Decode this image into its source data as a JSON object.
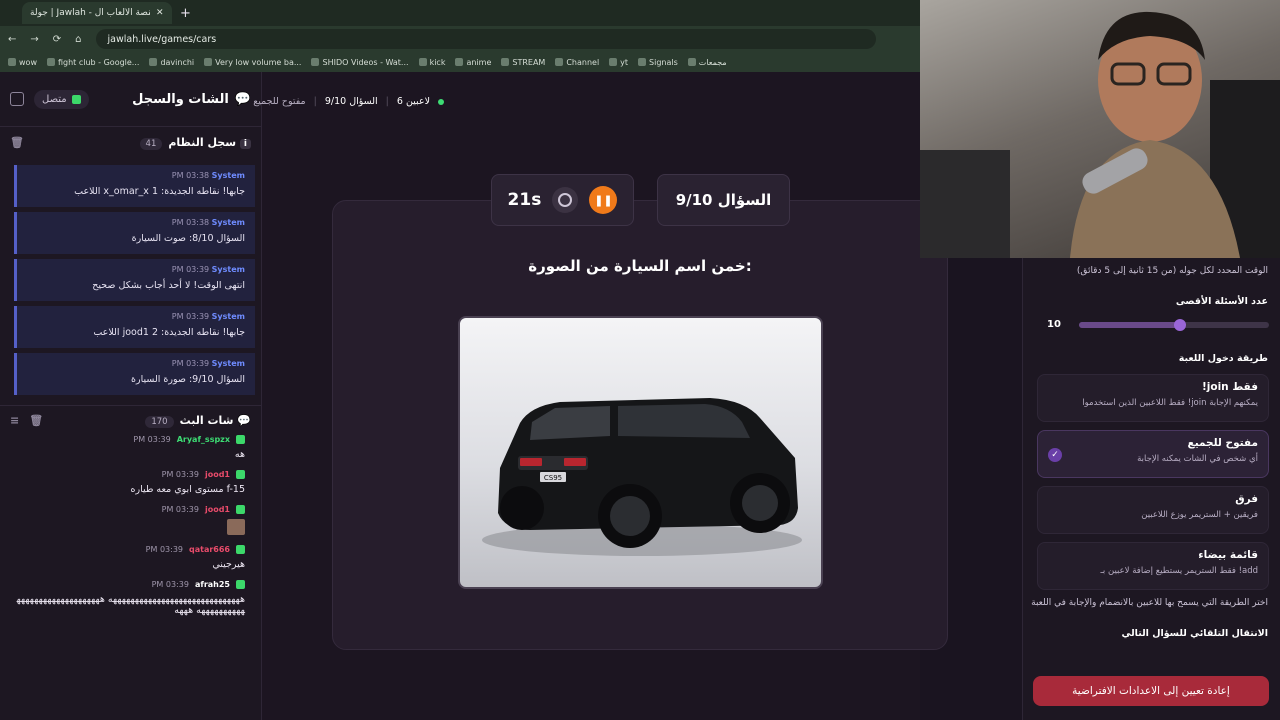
{
  "browser": {
    "tab_title": "جولة | Jawlah - منصة الألعاب ال...",
    "url": "jawlah.live/games/cars",
    "bookmarks": [
      "wow",
      "fight club - Google...",
      "davinchi",
      "Very low volume ba...",
      "SHIDO Videos - Wat...",
      "kick",
      "anime",
      "STREAM",
      "Channel",
      "yt",
      "Signals",
      "مجمعات"
    ]
  },
  "left_panel": {
    "title": "الشات والسجل",
    "status": "متصل",
    "system_log": {
      "title": "سجل النظام",
      "count": "41",
      "messages": [
        {
          "time": "PM 03:38",
          "sender": "System",
          "text": "اللاعب x_omar_x جابها! نقاطه الجديدة: 1"
        },
        {
          "time": "PM 03:38",
          "sender": "System",
          "text": "السؤال 8/10: صوت السيارة"
        },
        {
          "time": "PM 03:39",
          "sender": "System",
          "text": "انتهى الوقت! لا أحد أجاب بشكل صحيح"
        },
        {
          "time": "PM 03:39",
          "sender": "System",
          "text": "اللاعب jood1 جابها! نقاطه الجديدة: 2"
        },
        {
          "time": "PM 03:39",
          "sender": "System",
          "text": "السؤال 9/10: صورة السيارة"
        }
      ]
    },
    "live_chat": {
      "title": "شات البث",
      "count": "170",
      "messages": [
        {
          "time": "PM 03:39",
          "user": "Aryaf_sspzx",
          "color": "#3ddc74",
          "text": "هه"
        },
        {
          "time": "PM 03:39",
          "user": "jood1",
          "color": "#e84b6a",
          "text": "مستوى ابوي معه طياره f-15"
        },
        {
          "time": "PM 03:39",
          "user": "jood1",
          "color": "#e84b6a",
          "text": ""
        },
        {
          "time": "PM 03:39",
          "user": "qatar666",
          "color": "#e84b6a",
          "text": "هيرجيني"
        },
        {
          "time": "PM 03:39",
          "user": "afrah25",
          "color": "#ffffff",
          "text": "ههههههههههههههههههههههههههههههه ههههههههههههههههههههههههههههههه هههه"
        }
      ]
    }
  },
  "game": {
    "breadcrumb": {
      "players": "6 لاعبين",
      "question": "السؤال 9/10",
      "mode": "مفتوح للجميع"
    },
    "timer": "21s",
    "question_counter": "السؤال 9/10",
    "prompt": "خمن اسم السيارة من الصورة:",
    "plate_text": "CS95"
  },
  "settings": {
    "time_hint": "الوقت المحدد لكل جوله (من 15 ثانية إلى 5 دقائق)",
    "max_questions_label": "عدد الأسئلة الأقصى",
    "max_questions_value": "10",
    "max_questions_fraction": 0.53,
    "join_method_label": "طريقة دخول اللعبة",
    "options": [
      {
        "title": "!join فقط",
        "desc": "فقط اللاعبين الذين استخدموا !join يمكنهم الإجابة",
        "selected": false
      },
      {
        "title": "مفتوح للجميع",
        "desc": "أي شخص في الشات يمكنه الإجابة",
        "selected": true
      },
      {
        "title": "فرق",
        "desc": "فريقين + الستريمر يوزع اللاعبين",
        "selected": false
      },
      {
        "title": "قائمة بيضاء",
        "desc": "فقط الستريمر يستطيع إضافة لاعبين بـ !add",
        "selected": false
      }
    ],
    "join_hint": "اختر الطريقة التي يسمح بها للاعبين بالانضمام والإجابة في اللعبة",
    "auto_next_label": "الانتقال التلقائي للسؤال التالي",
    "reset_label": "إعادة تعيين إلى الاعدادات الافتراضية"
  }
}
